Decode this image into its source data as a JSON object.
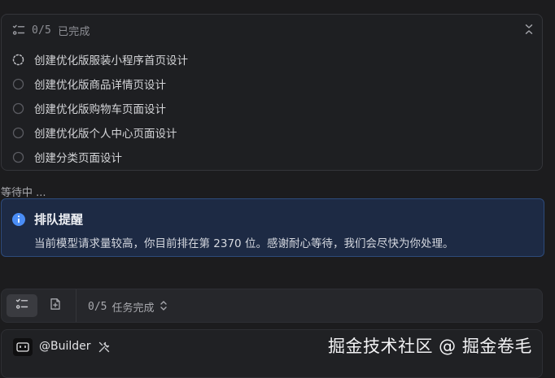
{
  "tasks": {
    "progress": "0/5",
    "progress_suffix": "已完成",
    "items": [
      {
        "label": "创建优化版服装小程序首页设计",
        "status": "in-progress"
      },
      {
        "label": "创建优化版商品详情页设计",
        "status": "pending"
      },
      {
        "label": "创建优化版购物车页面设计",
        "status": "pending"
      },
      {
        "label": "创建优化版个人中心页面设计",
        "status": "pending"
      },
      {
        "label": "创建分类页面设计",
        "status": "pending"
      }
    ]
  },
  "waiting_text": "等待中 ...",
  "queue_notice": {
    "title": "排队提醒",
    "message": "当前模型请求量较高，你目前排在第 2370 位。感谢耐心等待，我们会尽快为你处理。"
  },
  "toolbar": {
    "task_count": "0/5",
    "task_label": "任务完成"
  },
  "builder": {
    "agent_name": "@Builder"
  },
  "watermark": "掘金技术社区 @ 掘金卷毛",
  "colors": {
    "background": "#1c1c1e",
    "panel": "#1e1f22",
    "notice_bg": "#1d2a44",
    "notice_border": "#2d4a7a",
    "info_accent": "#4a8df6"
  },
  "icons": {
    "task_list": "checklist-icon",
    "collapse": "collapse-icon",
    "in_progress": "spinner-dashed-circle-icon",
    "pending": "empty-circle-icon",
    "info": "info-icon",
    "file": "file-add-icon",
    "sort": "chevron-up-down-icon",
    "bot": "bot-icon",
    "tools": "tools-icon"
  }
}
